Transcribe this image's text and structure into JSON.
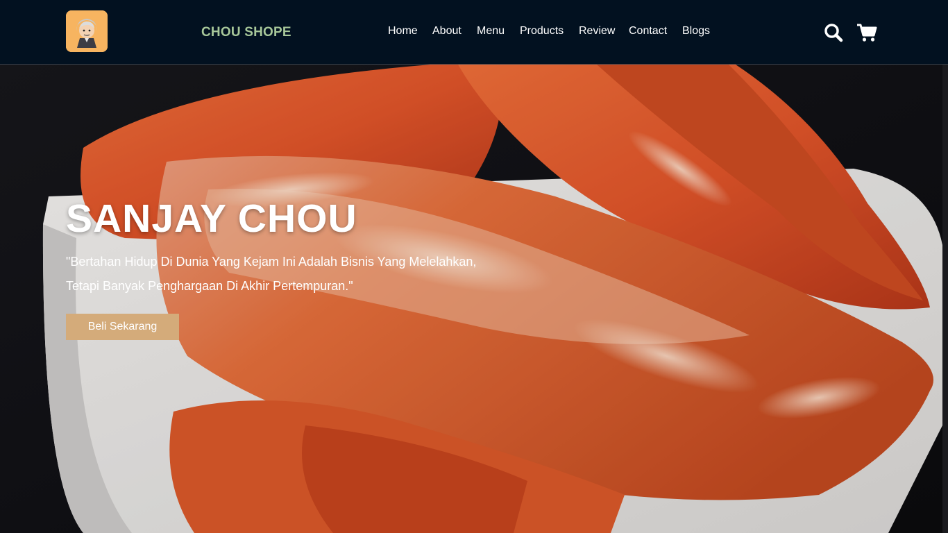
{
  "brand": {
    "name": "CHOU SHOPE"
  },
  "nav": {
    "items": [
      {
        "label": "Home"
      },
      {
        "label": "About"
      },
      {
        "label": "Menu"
      },
      {
        "label": "Products"
      },
      {
        "label": "Review"
      },
      {
        "label": "Contact"
      },
      {
        "label": "Blogs"
      }
    ],
    "icons": [
      "search-icon",
      "cart-icon"
    ]
  },
  "hero": {
    "title": "SANJAY CHOU",
    "quote": "\"Bertahan Hidup Di Dunia Yang Kejam Ini Adalah Bisnis Yang Melelahkan, Tetapi Banyak Penghargaan Di Akhir Pertempuran.\"",
    "cta_label": "Beli Sekarang"
  },
  "colors": {
    "navbar_bg": "#021120",
    "brand_text": "#a8c89a",
    "logo_bg": "#f7b460",
    "cta_bg": "#d4ab7a"
  }
}
